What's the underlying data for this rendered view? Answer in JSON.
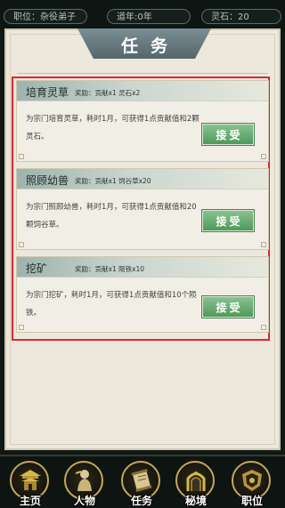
{
  "status": {
    "position": "职位：杂役弟子",
    "age": "道年:0年",
    "spirit_stones": "灵石：20"
  },
  "panel": {
    "title": "任务"
  },
  "tasks": [
    {
      "name": "培育灵草",
      "reward": "奖励：贡献x1 灵石x2",
      "description": "为宗门培育灵草，耗时1月，可获得1点贡献值和2颗灵石。",
      "button": "接受"
    },
    {
      "name": "照顾幼兽",
      "reward": "奖励：贡献x1 饲谷草x20",
      "description": "为宗门照顾幼兽，耗时1月，可获得1点贡献值和20颗饲谷草。",
      "button": "接受"
    },
    {
      "name": "挖矿",
      "reward": "奖励：贡献x1 陨铁x10",
      "description": "为宗门挖矿，耗时1月，可获得1点贡献值和10个陨铁。",
      "button": "接受"
    }
  ],
  "nav": [
    {
      "label": "主页",
      "icon": "palace-icon"
    },
    {
      "label": "人物",
      "icon": "character-icon"
    },
    {
      "label": "任务",
      "icon": "scroll-icon"
    },
    {
      "label": "秘境",
      "icon": "gate-icon"
    },
    {
      "label": "职位",
      "icon": "crest-icon"
    }
  ],
  "colors": {
    "accent_green": "#5aa565",
    "highlight_red": "#e0262e",
    "nav_gold": "#c4a85a"
  }
}
